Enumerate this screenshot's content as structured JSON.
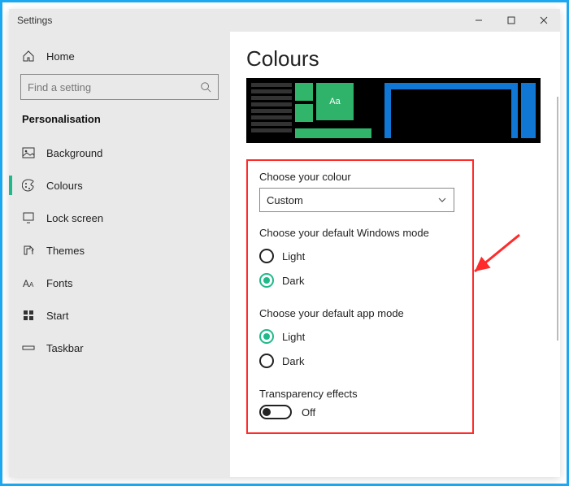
{
  "window": {
    "title": "Settings"
  },
  "sidebar": {
    "home": "Home",
    "search_placeholder": "Find a setting",
    "section": "Personalisation",
    "items": [
      {
        "label": "Background"
      },
      {
        "label": "Colours"
      },
      {
        "label": "Lock screen"
      },
      {
        "label": "Themes"
      },
      {
        "label": "Fonts"
      },
      {
        "label": "Start"
      },
      {
        "label": "Taskbar"
      }
    ]
  },
  "main": {
    "heading": "Colours",
    "preview_tile_text": "Aa",
    "choose_colour_label": "Choose your colour",
    "choose_colour_value": "Custom",
    "windows_mode_label": "Choose your default Windows mode",
    "windows_mode_options": {
      "light": "Light",
      "dark": "Dark"
    },
    "windows_mode_selected": "dark",
    "app_mode_label": "Choose your default app mode",
    "app_mode_options": {
      "light": "Light",
      "dark": "Dark"
    },
    "app_mode_selected": "light",
    "transparency_label": "Transparency effects",
    "transparency_value": "Off"
  }
}
